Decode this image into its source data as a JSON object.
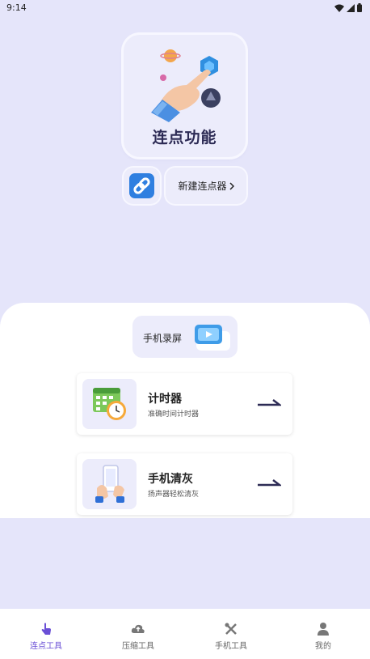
{
  "status_bar": {
    "time": "9:14"
  },
  "hero": {
    "title": "连点功能"
  },
  "actions": {
    "new_clicker_label": "新建连点器"
  },
  "record": {
    "label": "手机录屏"
  },
  "tools": [
    {
      "title": "计时器",
      "subtitle": "准确时间计时器"
    },
    {
      "title": "手机清灰",
      "subtitle": "扬声器轻松清灰"
    }
  ],
  "tabbar": {
    "active_color": "#6a4fd6",
    "items": [
      {
        "label": "连点工具",
        "icon": "tap-icon",
        "active": true
      },
      {
        "label": "压缩工具",
        "icon": "cloud-compress-icon",
        "active": false
      },
      {
        "label": "手机工具",
        "icon": "tools-icon",
        "active": false
      },
      {
        "label": "我的",
        "icon": "user-icon",
        "active": false
      }
    ]
  }
}
